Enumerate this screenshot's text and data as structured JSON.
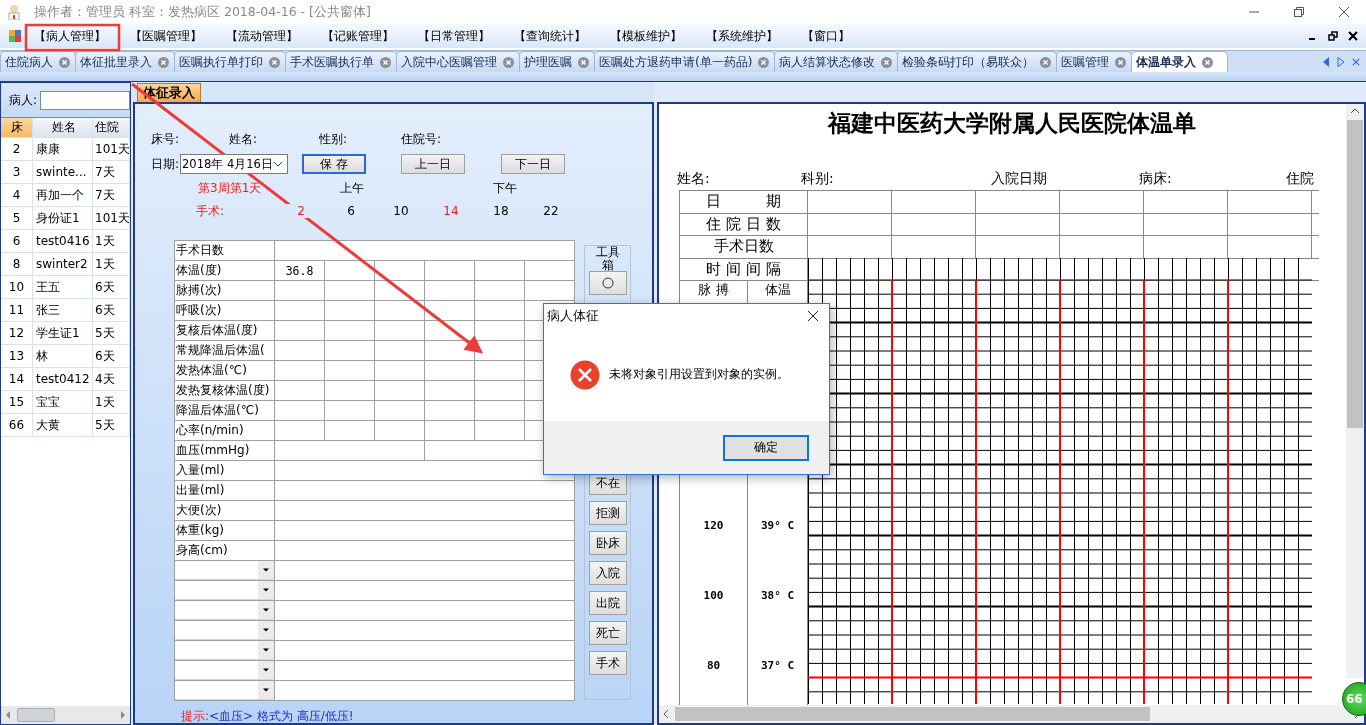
{
  "window": {
    "title": "操作者：管理员  科室：发热病区  2018-04-16 - [公共窗体]"
  },
  "menu": [
    "【病人管理】",
    "【医嘱管理】",
    "【流动管理】",
    "【记账管理】",
    "【日常管理】",
    "【查询统计】",
    "【模板维护】",
    "【系统维护】",
    "【窗口】"
  ],
  "tabs": [
    {
      "label": "住院病人",
      "selected": false
    },
    {
      "label": "体征批里录入",
      "selected": false
    },
    {
      "label": "医嘱执行单打印",
      "selected": false
    },
    {
      "label": "手术医嘱执行单",
      "selected": false
    },
    {
      "label": "入院中心医嘱管理",
      "selected": false
    },
    {
      "label": "护理医嘱",
      "selected": false
    },
    {
      "label": "医嘱处方退药申请(单一药品)",
      "selected": false
    },
    {
      "label": "病人结算状态修改",
      "selected": false
    },
    {
      "label": "检验条码打印（易联众）",
      "selected": false
    },
    {
      "label": "医嘱管理",
      "selected": false
    },
    {
      "label": "体温单录入",
      "selected": true
    }
  ],
  "patients": {
    "label": "病人:",
    "columns": [
      {
        "label": "床",
        "selected": true
      },
      {
        "label": "姓名",
        "selected": false
      },
      {
        "label": "住院",
        "selected": false
      }
    ],
    "rows": [
      [
        "2",
        "康康",
        "101天"
      ],
      [
        "3",
        "swinte...",
        "7天"
      ],
      [
        "4",
        "再加一个",
        "7天"
      ],
      [
        "5",
        "身份证1",
        "101天"
      ],
      [
        "6",
        "test0416",
        "1天"
      ],
      [
        "8",
        "swinter2",
        "1天"
      ],
      [
        "10",
        "王五",
        "6天"
      ],
      [
        "11",
        "张三",
        "6天"
      ],
      [
        "12",
        "学生证1",
        "5天"
      ],
      [
        "13",
        "林",
        "6天"
      ],
      [
        "14",
        "test0412",
        "4天"
      ],
      [
        "15",
        "宝宝",
        "1天"
      ],
      [
        "66",
        "大黄",
        "5天"
      ]
    ]
  },
  "form": {
    "tab": "体征录入",
    "fields": [
      "床号:",
      "姓名:",
      "性别:",
      "住院号:"
    ],
    "date_label": "日期:",
    "date_value": "2018年  4月16日",
    "buttons": [
      {
        "label": "保 存",
        "focused": true
      },
      {
        "label": "上一日",
        "focused": false
      },
      {
        "label": "下一日",
        "focused": false
      }
    ],
    "week": "第3周第1天",
    "am": "上午",
    "pm": "下午",
    "surgery_label": "手术:",
    "times": [
      {
        "label": "2",
        "highlight": true
      },
      {
        "label": "6",
        "highlight": false
      },
      {
        "label": "10",
        "highlight": false
      },
      {
        "label": "14",
        "highlight": true
      },
      {
        "label": "18",
        "highlight": false
      },
      {
        "label": "22",
        "highlight": false
      }
    ],
    "rows": [
      {
        "kind": "single",
        "label": "手术日数"
      },
      {
        "kind": "six",
        "label": "体温(度)",
        "values": [
          "36.8"
        ]
      },
      {
        "kind": "six",
        "label": "脉搏(次)"
      },
      {
        "kind": "six",
        "label": "呼吸(次)"
      },
      {
        "kind": "six",
        "label": "复核后体温(度)"
      },
      {
        "kind": "six",
        "label": "常规降温后体温("
      },
      {
        "kind": "six",
        "label": "发热体温(℃)"
      },
      {
        "kind": "six",
        "label": "发热复核体温(度)"
      },
      {
        "kind": "six",
        "label": "降温后体温(℃)"
      },
      {
        "kind": "six",
        "label": "心率(n/min)"
      },
      {
        "kind": "pair",
        "label": "血压(mmHg)"
      },
      {
        "kind": "single",
        "label": "入量(ml)"
      },
      {
        "kind": "single",
        "label": "出量(ml)"
      },
      {
        "kind": "single",
        "label": "大便(次)"
      },
      {
        "kind": "single",
        "label": "体重(kg)"
      },
      {
        "kind": "single",
        "label": "身高(cm)"
      },
      {
        "kind": "dropdown"
      },
      {
        "kind": "dropdown"
      },
      {
        "kind": "dropdown"
      },
      {
        "kind": "dropdown"
      },
      {
        "kind": "dropdown"
      },
      {
        "kind": "dropdown"
      },
      {
        "kind": "dropdown"
      }
    ],
    "toolbox": {
      "title": "工具箱",
      "buttons": [
        "不在",
        "拒测",
        "卧床",
        "入院",
        "出院",
        "死亡",
        "手术"
      ]
    },
    "hint_label": "提示:",
    "hint": "<血压> 格式为 高压/低压!"
  },
  "sheet": {
    "title": "福建中医药大学附属人民医院体温单",
    "info": [
      "姓名:",
      "科别:",
      "入院日期",
      "病床:",
      "住院"
    ],
    "rows": [
      "日　　　期",
      "住 院 日 数",
      "手术日数",
      "时 间 间 隔"
    ],
    "pulse_label": "脉 搏",
    "temp_label": "体温",
    "scale": [
      {
        "pulse": "120",
        "temp": "39° C"
      },
      {
        "pulse": "100",
        "temp": "38° C"
      },
      {
        "pulse": "80",
        "temp": "37° C"
      }
    ]
  },
  "dialog": {
    "title": "病人体征",
    "message": "未将对象引用设置到对象的实例。",
    "button": "确定"
  },
  "badge": "66"
}
